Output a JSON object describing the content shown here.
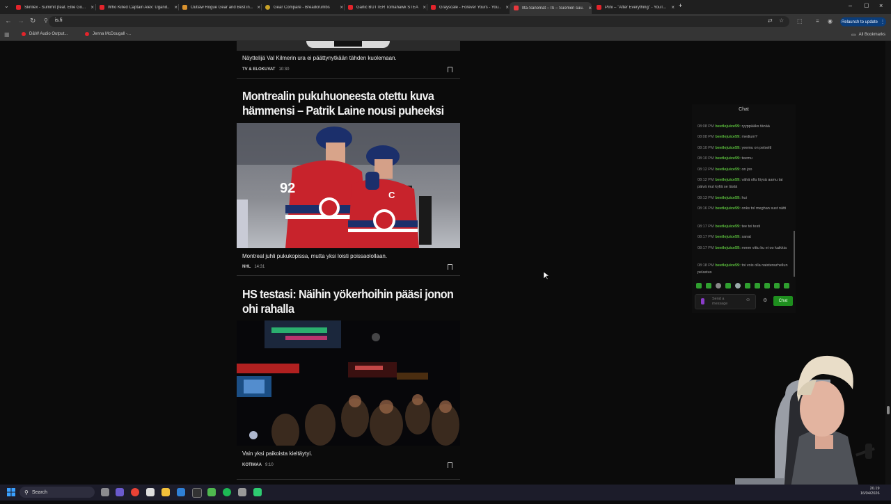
{
  "browser": {
    "tabs": [
      {
        "title": "Skrillex - Summit (feat. Ellie Go...",
        "favicon_color": "#e3242b",
        "active": false
      },
      {
        "title": "Who Killed Captain Alex: Ugand...",
        "favicon_color": "#e3242b",
        "active": false
      },
      {
        "title": "Outlaw Rogue Gear and Best in...",
        "favicon_color": "#d9922e",
        "active": false
      },
      {
        "title": "Gear Compare - Breadcrumbs",
        "favicon_color": "#c9a227",
        "active": false
      },
      {
        "title": "Garlic BUTTER Tomahawk STEA...",
        "favicon_color": "#e3242b",
        "active": false
      },
      {
        "title": "Grayscale - Forever Yours - You...",
        "favicon_color": "#e3242b",
        "active": false
      },
      {
        "title": "Ilta-Sanomat – IS – Suomen suu...",
        "favicon_color": "#e8383d",
        "active": true
      },
      {
        "title": "Plini – \"After Everything\" - YouT...",
        "favicon_color": "#e3242b",
        "active": false
      }
    ],
    "url": "is.fi",
    "relaunch_label": "Relaunch to update",
    "bookmarks": [
      {
        "label": "D&W Audio Output..."
      },
      {
        "label": "Jenna McDougall -..."
      }
    ],
    "all_bookmarks_label": "All Bookmarks"
  },
  "articles": [
    {
      "lead": "Näyttelijä Val Kilmerin ura ei päättynytkään tähden kuolemaan.",
      "category": "TV & ELOKUVAT",
      "time": "10:30"
    },
    {
      "title": "Montrealin pukuhuoneesta otettu kuva hämmensi – Patrik Laine nousi puheeksi",
      "lead": "Montreal juhli pukukopissa, mutta yksi loisti poissaolollaan.",
      "category": "NHL",
      "time": "14:31"
    },
    {
      "title": "HS testasi: Näihin yökerhoihin pääsi jonon ohi rahalla",
      "lead": "Vain yksi paikoista kieltäytyi.",
      "category": "KOTIMAA",
      "time": "9:10"
    }
  ],
  "chat": {
    "header": "Chat",
    "messages": [
      {
        "time": "08:08 PM",
        "user": "beetlejuice59:",
        "text": "ryyppääks tänää"
      },
      {
        "time": "08:08 PM",
        "user": "beetlejuice59:",
        "text": "medium?"
      },
      {
        "time": "08:10 PM",
        "user": "beetlejuice59:",
        "text": "yeemu on pelseltl"
      },
      {
        "time": "08:10 PM",
        "user": "beetlejuice59:",
        "text": "teemu"
      },
      {
        "time": "08:12 PM",
        "user": "beetlejuice59:",
        "text": "on joo"
      },
      {
        "time": "08:12 PM",
        "user": "beetlejuice59:",
        "text": "vähä ollu löysä aamu tai päivä mut kyllä se tästä"
      },
      {
        "time": "08:13 PM",
        "user": "beetlejuice59:",
        "text": "hui"
      },
      {
        "time": "08:16 PM",
        "user": "beetlejuice59:",
        "text": "onks tol meghan sust nätti"
      },
      {
        "time": "08:17 PM",
        "user": "beetlejuice59:",
        "text": "tee toi testi"
      },
      {
        "time": "08:17 PM",
        "user": "beetlejuice59:",
        "text": "sanat"
      },
      {
        "time": "08:17 PM",
        "user": "beetlejuice59:",
        "text": "mmm vittu ku ei oo kaikkia"
      },
      {
        "time": "08:18 PM",
        "user": "beetlejuice59:",
        "text": "toi vois olla naistenurhellun pelastus"
      }
    ],
    "input_placeholder": "Send a message",
    "send_label": "Chat"
  },
  "taskbar": {
    "search_label": "Search",
    "time": "20.19",
    "date": "16/04/2026"
  }
}
